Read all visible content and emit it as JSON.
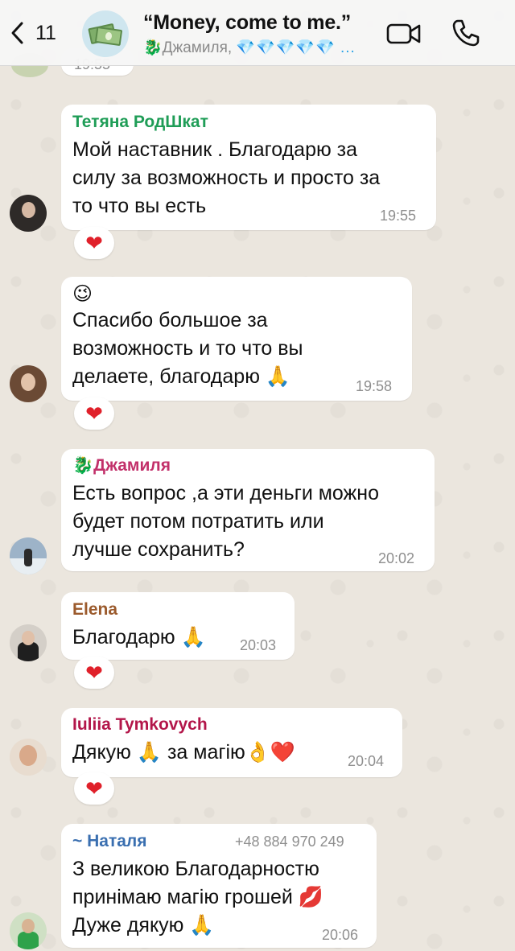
{
  "header": {
    "back_count": "11",
    "title": "“Money, come to me.”",
    "subtitle_name": "🐉Джамиля,",
    "subtitle_gems": "💎💎💎💎💎 ...",
    "top_time_fragment": "19:55"
  },
  "messages": [
    {
      "sender": "Тетяна РодШкат",
      "sender_color": "#1f9d57",
      "lines": [
        "Мой наставник . Благодарю за",
        "силу за возможность и просто за",
        "то что вы есть"
      ],
      "time": "19:55",
      "reaction": "❤"
    },
    {
      "sender": "",
      "lines": [
        "😉",
        "Спасибо большое за",
        "возможность и то что вы",
        "делаете, благодарю 🙏"
      ],
      "time": "19:58",
      "reaction": "❤"
    },
    {
      "sender": "🐉Джамиля",
      "sender_color": "#c2306a",
      "lines": [
        "Есть вопрос ,а эти деньги можно",
        "будет потом потратить или",
        "лучше сохранить?"
      ],
      "time": "20:02"
    },
    {
      "sender": "Elena",
      "sender_color": "#9b5a2c",
      "lines": [
        "Благодарю 🙏"
      ],
      "time": "20:03",
      "reaction": "❤"
    },
    {
      "sender": "Iuliia Tymkovych",
      "sender_color": "#b3164a",
      "lines": [
        "Дякую 🙏 за магію👌❤️"
      ],
      "time": "20:04",
      "reaction": "❤"
    },
    {
      "sender": "~ Наталя",
      "sender_color": "#3a6fb0",
      "phone": "+48 884 970 249",
      "lines": [
        "З великою Благодарностю",
        "принімаю магію грошей 💋",
        "Дуже дякую 🙏"
      ],
      "time": "20:06"
    }
  ]
}
